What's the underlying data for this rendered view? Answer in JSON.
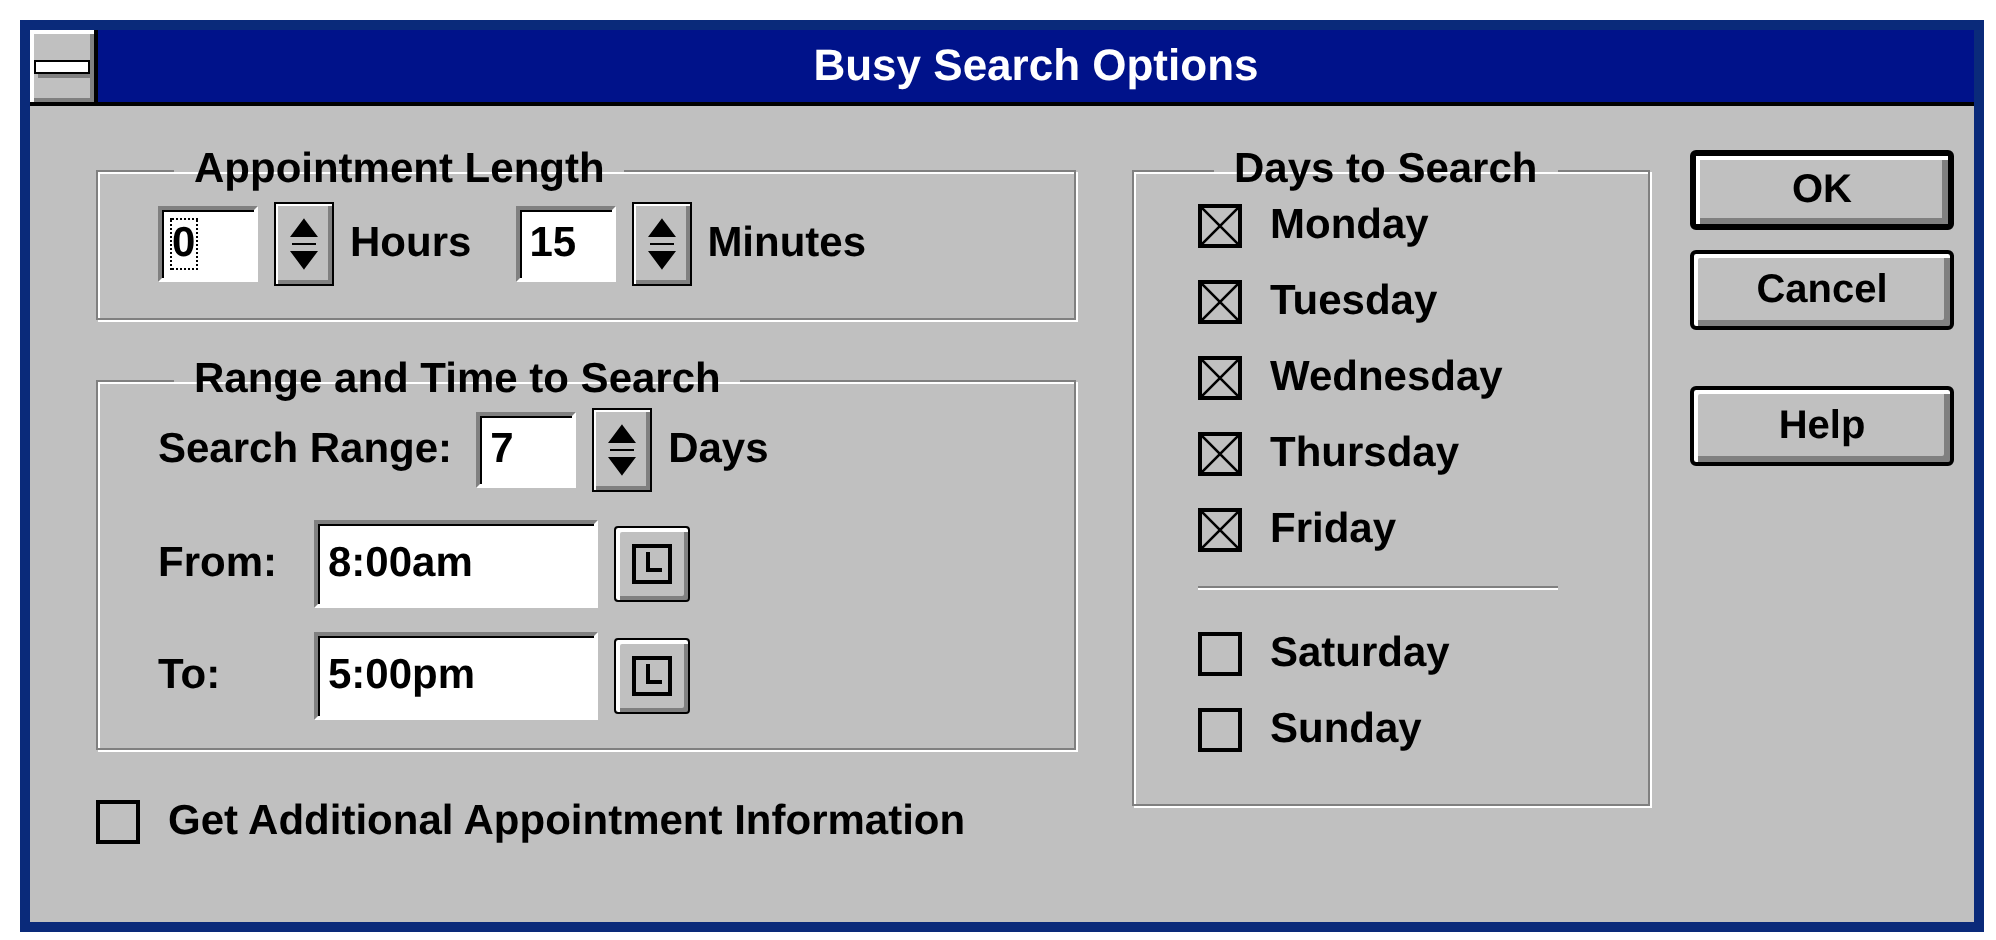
{
  "window": {
    "title": "Busy Search Options"
  },
  "appointment_length": {
    "legend": "Appointment Length",
    "hours": {
      "value": "0",
      "label": "Hours"
    },
    "minutes": {
      "value": "15",
      "label": "Minutes"
    }
  },
  "range": {
    "legend": "Range and Time to Search",
    "search_range": {
      "label": "Search Range:",
      "value": "7",
      "unit": "Days"
    },
    "from": {
      "label": "From:",
      "value": "8:00am"
    },
    "to": {
      "label": "To:",
      "value": "5:00pm"
    }
  },
  "additional_info": {
    "label": "Get Additional Appointment Information",
    "checked": false
  },
  "days": {
    "legend": "Days to Search",
    "weekdays": [
      {
        "label": "Monday",
        "checked": true
      },
      {
        "label": "Tuesday",
        "checked": true
      },
      {
        "label": "Wednesday",
        "checked": true
      },
      {
        "label": "Thursday",
        "checked": true
      },
      {
        "label": "Friday",
        "checked": true
      }
    ],
    "weekend": [
      {
        "label": "Saturday",
        "checked": false
      },
      {
        "label": "Sunday",
        "checked": false
      }
    ]
  },
  "buttons": [
    {
      "label": "OK",
      "default": true
    },
    {
      "label": "Cancel",
      "default": false
    },
    {
      "label": "Help",
      "default": false
    }
  ]
}
